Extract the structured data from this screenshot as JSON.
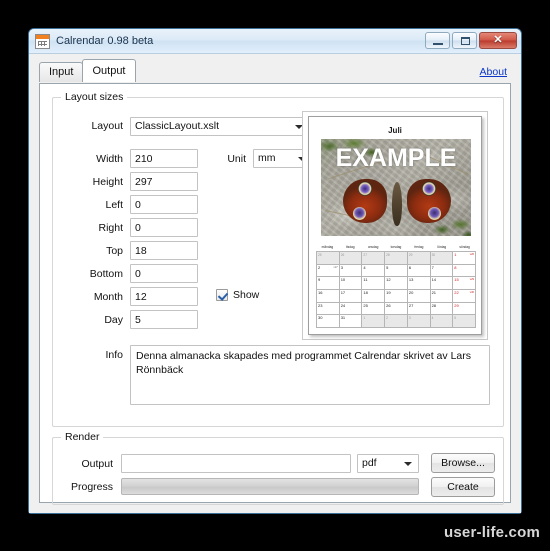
{
  "window": {
    "title": "Calrendar 0.98 beta",
    "app_icon": "calendar-icon",
    "minimize_label": "",
    "maximize_label": "",
    "close_label": "✕"
  },
  "tabs": [
    {
      "label": "Input",
      "active": false
    },
    {
      "label": "Output",
      "active": true
    }
  ],
  "about_link": "About",
  "layout_group": {
    "title": "Layout sizes",
    "layout_label": "Layout",
    "layout_value": "ClassicLayout.xslt",
    "unit_label": "Unit",
    "unit_value": "mm",
    "fields": [
      {
        "label": "Width",
        "value": "210"
      },
      {
        "label": "Height",
        "value": "297"
      },
      {
        "label": "Left",
        "value": "0"
      },
      {
        "label": "Right",
        "value": "0"
      },
      {
        "label": "Top",
        "value": "18"
      },
      {
        "label": "Bottom",
        "value": "0"
      },
      {
        "label": "Month",
        "value": "12"
      },
      {
        "label": "Day",
        "value": "5"
      }
    ],
    "show_label": "Show",
    "show_checked": true,
    "info_label": "Info",
    "info_value": "Denna almanacka skapades med programmet Calrendar skrivet av Lars Rönnbäck"
  },
  "render_group": {
    "title": "Render",
    "output_label": "Output",
    "output_value": "",
    "format_value": "pdf",
    "progress_label": "Progress",
    "progress_percent": 0,
    "browse_label": "Browse...",
    "create_label": "Create"
  },
  "preview": {
    "month_title": "Juli",
    "photo_overlay_text": "EXAMPLE",
    "weekdays": [
      "måndag",
      "tisdag",
      "onsdag",
      "torsdag",
      "fredag",
      "lördag",
      "söndag"
    ],
    "weeks": [
      [
        {
          "num": "25",
          "dim": true,
          "grey": true,
          "note": ""
        },
        {
          "num": "26",
          "dim": true,
          "grey": true,
          "note": ""
        },
        {
          "num": "27",
          "dim": true,
          "grey": true,
          "note": ""
        },
        {
          "num": "28",
          "dim": true,
          "grey": true,
          "note": ""
        },
        {
          "num": "29",
          "dim": true,
          "grey": true,
          "note": ""
        },
        {
          "num": "30",
          "dim": true,
          "grey": true,
          "note": ""
        },
        {
          "num": "1",
          "sunday": true,
          "grey": false,
          "note": "v26"
        }
      ],
      [
        {
          "num": "2",
          "note": "v27"
        },
        {
          "num": "3",
          "note": ""
        },
        {
          "num": "4",
          "note": ""
        },
        {
          "num": "5",
          "note": ""
        },
        {
          "num": "6",
          "note": ""
        },
        {
          "num": "7",
          "note": ""
        },
        {
          "num": "8",
          "sunday": true,
          "note": ""
        }
      ],
      [
        {
          "num": "9",
          "note": ""
        },
        {
          "num": "10",
          "note": ""
        },
        {
          "num": "11",
          "note": ""
        },
        {
          "num": "12",
          "note": ""
        },
        {
          "num": "13",
          "note": ""
        },
        {
          "num": "14",
          "note": ""
        },
        {
          "num": "15",
          "sunday": true,
          "note": "v29"
        }
      ],
      [
        {
          "num": "16",
          "note": ""
        },
        {
          "num": "17",
          "note": ""
        },
        {
          "num": "18",
          "note": ""
        },
        {
          "num": "19",
          "note": ""
        },
        {
          "num": "20",
          "note": ""
        },
        {
          "num": "21",
          "note": ""
        },
        {
          "num": "22",
          "sunday": true,
          "note": "v30"
        }
      ],
      [
        {
          "num": "23",
          "note": ""
        },
        {
          "num": "24",
          "note": ""
        },
        {
          "num": "25",
          "note": ""
        },
        {
          "num": "26",
          "note": ""
        },
        {
          "num": "27",
          "note": ""
        },
        {
          "num": "28",
          "note": ""
        },
        {
          "num": "29",
          "sunday": true,
          "note": ""
        }
      ],
      [
        {
          "num": "30",
          "note": ""
        },
        {
          "num": "31",
          "note": ""
        },
        {
          "num": "1",
          "dim": true,
          "grey": true,
          "note": ""
        },
        {
          "num": "2",
          "dim": true,
          "grey": true,
          "note": ""
        },
        {
          "num": "3",
          "dim": true,
          "grey": true,
          "note": ""
        },
        {
          "num": "4",
          "dim": true,
          "grey": true,
          "note": ""
        },
        {
          "num": "5",
          "dim": true,
          "grey": true,
          "note": ""
        }
      ]
    ]
  },
  "watermark": "user-life.com",
  "colors": {
    "accent_link": "#0b36c8",
    "close_button": "#b93b2d",
    "icon_orange": "#f08020",
    "sunday_red": "#cf1b1b",
    "desktop_background": "#000000"
  }
}
